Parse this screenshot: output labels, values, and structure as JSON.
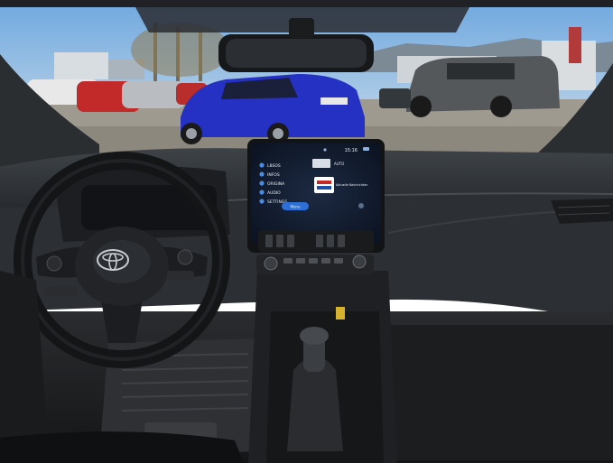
{
  "photo": {
    "subject": "car interior dashboard",
    "brand_emblem": "toyota-logo-icon"
  },
  "infotainment": {
    "time": "15:16",
    "status_icons": [
      "bluetooth-icon",
      "signal-icon",
      "battery-icon"
    ],
    "menu_items": [
      {
        "label": "LBSOS",
        "icon": "phone-icon"
      },
      {
        "label": "INFOS",
        "icon": "info-icon"
      },
      {
        "label": "ORIGINA",
        "icon": "globe-icon"
      },
      {
        "label": "AUDIO",
        "icon": "music-icon"
      },
      {
        "label": "SETTINGS",
        "icon": "gear-icon"
      }
    ],
    "media_title": "AUTO",
    "media_sub": "Aktuelle Nachrichten",
    "button_label": "Menu",
    "colors": {
      "screen_bg": "#0f1a2b",
      "accent": "#2d6fd6"
    }
  },
  "colors": {
    "sky": "#7fb2df",
    "blue_car": "#2531b8",
    "dashboard": "#2a2d31",
    "dashboard_top": "#3b3f44"
  }
}
